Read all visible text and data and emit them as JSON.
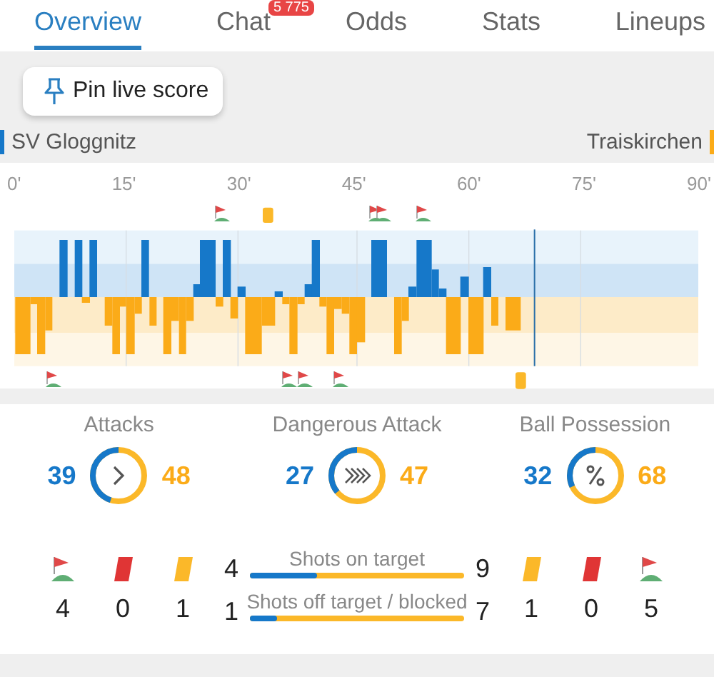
{
  "tabs": [
    {
      "label": "Overview",
      "selected": true
    },
    {
      "label": "Chat",
      "selected": false,
      "badge": "5 775"
    },
    {
      "label": "Odds",
      "selected": false
    },
    {
      "label": "Stats",
      "selected": false
    },
    {
      "label": "Lineups",
      "selected": false
    }
  ],
  "pin_button": {
    "label": "Pin live score"
  },
  "teams": {
    "home": "SV Gloggnitz",
    "away": "Traiskirchen"
  },
  "timeline": {
    "ticks": [
      "0'",
      "15'",
      "30'",
      "45'",
      "60'",
      "75'",
      "90'"
    ]
  },
  "stats": [
    {
      "kind": "attacks",
      "label": "Attacks",
      "home": "39",
      "away": "48",
      "level": 0.45
    },
    {
      "kind": "dangerous",
      "label": "Dangerous Attack",
      "home": "27",
      "away": "47",
      "level": 0.36
    },
    {
      "kind": "possession",
      "label": "Ball Possession",
      "home": "32",
      "away": "68",
      "level": 0.32
    }
  ],
  "home_events": [
    {
      "kind": "corner",
      "count": "4"
    },
    {
      "kind": "red",
      "count": "0"
    },
    {
      "kind": "yellow",
      "count": "1"
    }
  ],
  "away_events": [
    {
      "kind": "yellow",
      "count": "1"
    },
    {
      "kind": "red",
      "count": "0"
    },
    {
      "kind": "corner",
      "count": "5"
    }
  ],
  "shots": [
    {
      "label": "Shots on target",
      "home": "4",
      "away": "9",
      "level": 0.31
    },
    {
      "label": "Shots off target / blocked",
      "home": "1",
      "away": "7",
      "level": 0.125
    }
  ]
}
